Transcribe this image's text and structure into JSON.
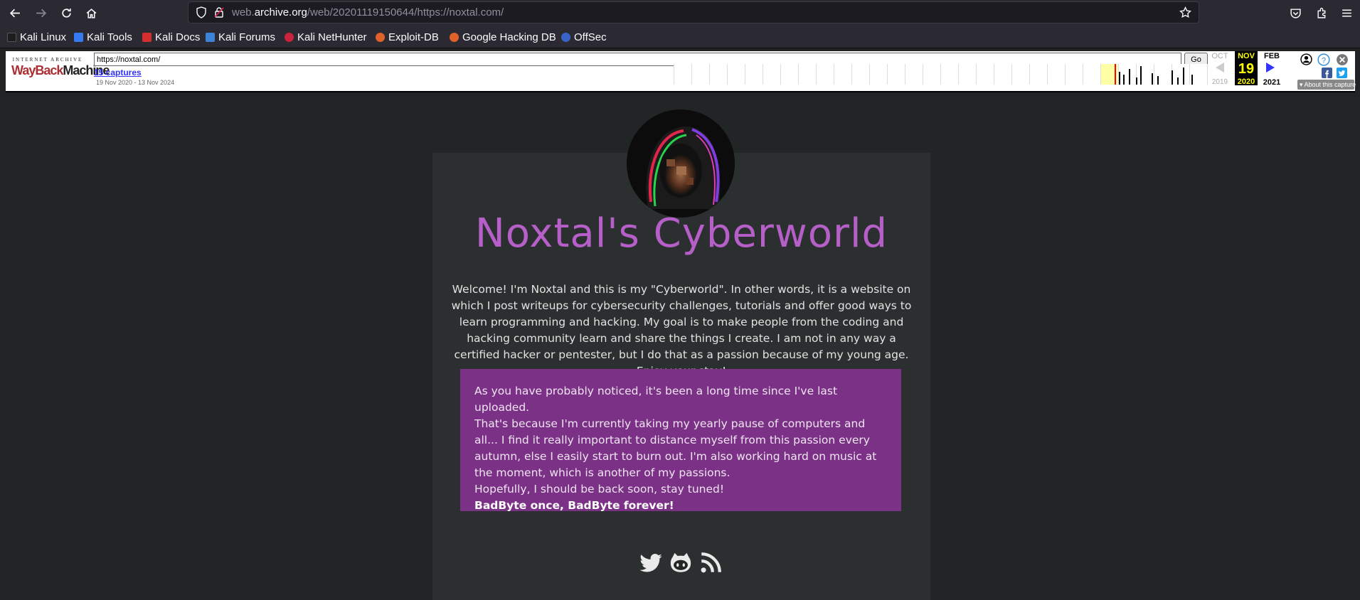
{
  "browser": {
    "url_host": "web.archive.org",
    "url_rest": "/web/20201119150644/https://noxtal.com/",
    "url_prefix": "web.",
    "url_domain": "archive.org",
    "bookmarks": [
      "Kali Linux",
      "Kali Tools",
      "Kali Docs",
      "Kali Forums",
      "Kali NetHunter",
      "Exploit-DB",
      "Google Hacking DB",
      "OffSec"
    ],
    "icons": [
      "back-icon",
      "forward-icon",
      "reload-icon",
      "home-icon",
      "shield-icon",
      "lock-icon",
      "star-icon",
      "pocket-icon",
      "extensions-icon",
      "menu-icon"
    ]
  },
  "wayback": {
    "logo_top": "INTERNET ARCHIVE",
    "logo_way": "WayBack",
    "logo_machine": "Machine",
    "url_value": "https://noxtal.com/",
    "go_label": "Go",
    "captures": "15 captures",
    "range": "19 Nov 2020 - 13 Nov 2024",
    "prev_month": "OCT",
    "prev_year": "2019",
    "cur_month": "NOV",
    "cur_day": "19",
    "cur_year": "2020",
    "next_month": "FEB",
    "next_year": "2021",
    "about": "About this capture",
    "accent": "#ffff00"
  },
  "page": {
    "title": "Noxtal's Cyberworld",
    "intro": "Welcome! I'm Noxtal and this is my \"Cyberworld\". In other words, it is a website on which I post writeups for cybersecurity challenges, tutorials and offer good ways to learn programming and hacking. My goal is to make people from the coding and hacking community learn and share the things I create. I am not in any way a certified hacker or pentester, but I do that as a passion because of my young age. Enjoy your stay!",
    "notice_l1": "As you have probably noticed, it's been a long time since I've last uploaded.",
    "notice_l2": "That's because I'm currently taking my yearly pause of computers and all... I find it really important to distance myself from this passion every autumn, else I easily start to burn out. I'm also working hard on music at the moment, which is another of my passions.",
    "notice_l3": "Hopefully, I should be back soon, stay tuned!",
    "notice_bold": "BadByte once, BadByte forever!",
    "socials": [
      "twitter-icon",
      "github-icon",
      "rss-icon"
    ],
    "title_color": "#b65fc9",
    "notice_color": "#7b3286"
  }
}
